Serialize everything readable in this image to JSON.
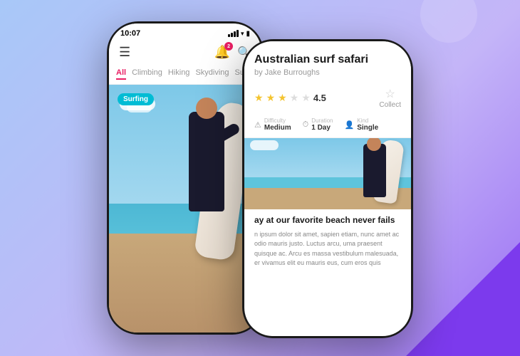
{
  "background": {
    "color_start": "#a8c8f8",
    "color_end": "#9b6ef3"
  },
  "phone1": {
    "time": "10:07",
    "nav": {
      "hamburger": "☰",
      "bell_badge": "2",
      "categories": [
        {
          "label": "All",
          "active": true
        },
        {
          "label": "Climbing",
          "active": false
        },
        {
          "label": "Hiking",
          "active": false
        },
        {
          "label": "Skydiving",
          "active": false
        },
        {
          "label": "Surfing",
          "active": false
        }
      ]
    },
    "card": {
      "badge_label": "Surfing",
      "indicator": "1"
    }
  },
  "phone2": {
    "detail": {
      "title": "Australian surf safari",
      "author": "by Jake Burroughs",
      "rating_value": "4.5",
      "stars_filled": 3,
      "stars_empty": 2,
      "collect_label": "Collect",
      "meta": [
        {
          "icon": "⚠",
          "label": "Difficulty",
          "value": "Medium"
        },
        {
          "icon": "⏱",
          "label": "Duration",
          "value": "1 Day"
        },
        {
          "icon": "👤",
          "label": "Kind",
          "value": "Single"
        }
      ],
      "description_heading": "ay at our favorite beach never fails",
      "description_text": "n ipsum dolor sit amet, sapien etiam, nunc amet ac odio mauris justo. Luctus arcu, uma praesent quisque ac. Arcu es massa vestibulum malesuada, er vivamus elit eu mauris eus, cum eros quis"
    }
  }
}
